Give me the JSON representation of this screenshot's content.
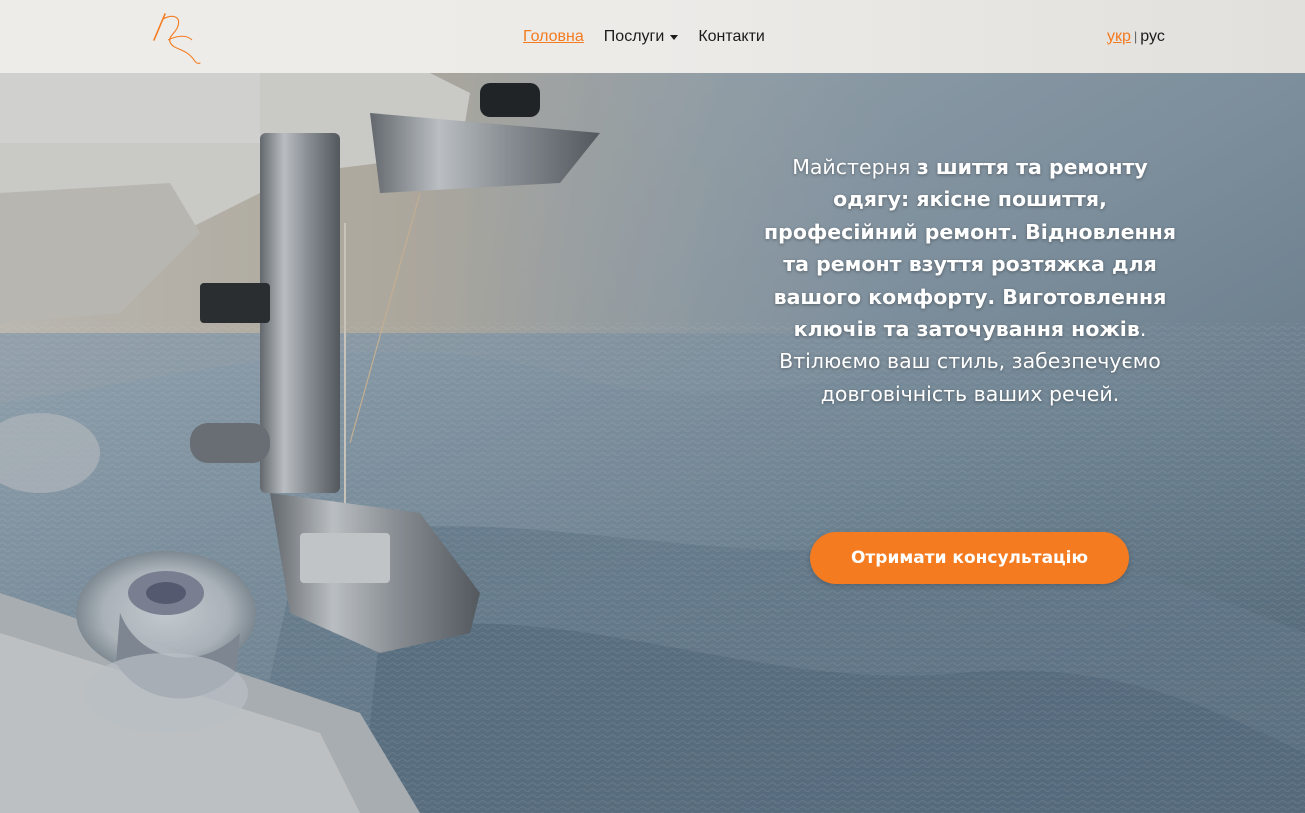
{
  "header": {
    "nav": {
      "home": "Головна",
      "services": "Послуги",
      "contacts": "Контакти"
    },
    "lang": {
      "ukr": "укр",
      "separator": "|",
      "rus": "рус"
    }
  },
  "hero": {
    "text": {
      "p1": "Майстерня ",
      "b1": "з шиття та ремонту одягу: якісне пошиття, професійний ремонт. Відновлення та ремонт взуття розтяжка для вашого комфорту. Виготовлення ключів та заточування ножів",
      "p2": ". Втілюємо ваш стиль, забезпечуємо довговічність ваших речей."
    },
    "cta_label": "Отримати консультацію"
  },
  "colors": {
    "accent": "#f47b20",
    "text_dark": "#1b1b1b",
    "header_bg": "#eeece8"
  },
  "icons": [
    "logo-needle-thread-icon",
    "chevron-down-icon"
  ]
}
